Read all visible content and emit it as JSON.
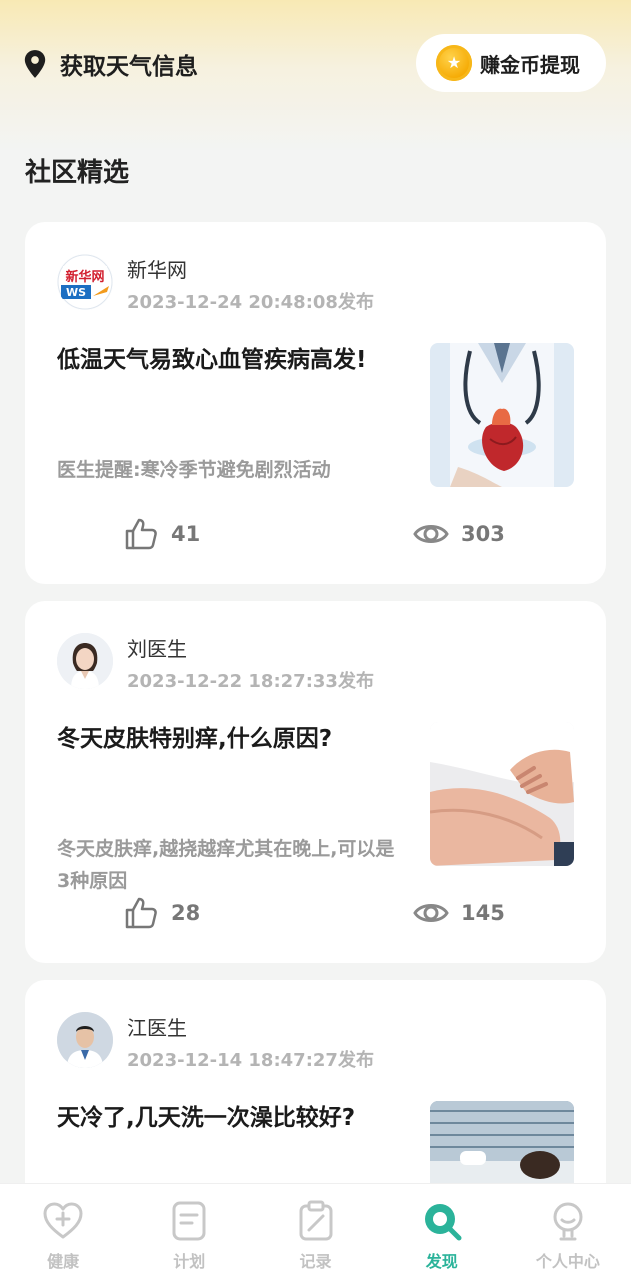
{
  "header": {
    "location_label": "获取天气信息",
    "coin_button_label": "赚金币提现"
  },
  "section_title": "社区精选",
  "posts": [
    {
      "author": "新华网",
      "time": "2023-12-24 20:48:08发布",
      "title": "低温天气易致心血管疾病高发!",
      "summary": "医生提醒:寒冷季节避免剧烈活动",
      "likes": "41",
      "views": "303",
      "avatar_text": "新华网",
      "avatar_sub": "WS"
    },
    {
      "author": "刘医生",
      "time": "2023-12-22 18:27:33发布",
      "title": "冬天皮肤特别痒,什么原因?",
      "summary": "冬天皮肤痒,越挠越痒尤其在晚上,可以是3种原因",
      "likes": "28",
      "views": "145"
    },
    {
      "author": "江医生",
      "time": "2023-12-14 18:47:27发布",
      "title": "天冷了,几天洗一次澡比较好?"
    }
  ],
  "tabs": [
    {
      "label": "健康",
      "icon": "heart-plus-icon"
    },
    {
      "label": "计划",
      "icon": "plan-icon"
    },
    {
      "label": "记录",
      "icon": "record-icon"
    },
    {
      "label": "发现",
      "icon": "discover-icon",
      "active": true
    },
    {
      "label": "个人中心",
      "icon": "profile-icon"
    }
  ],
  "colors": {
    "accent": "#2bb39a",
    "coin": "#f5a800"
  }
}
